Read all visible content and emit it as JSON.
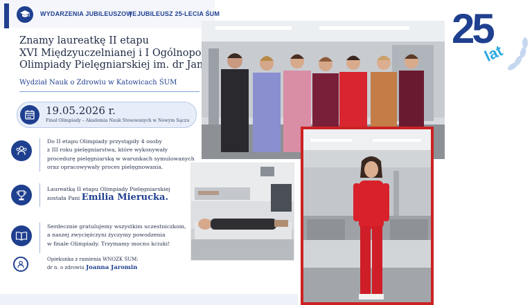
{
  "topbar": {
    "left_label": "WYDARZENIA JUBILEUSZOWE",
    "separator": "|",
    "right_label": "JUBILEUSZ 25-LECIA ŚUM"
  },
  "headline": {
    "lines": [
      "Znamy laureatkę II etapu",
      "XVI Międzyuczelnianej i I Ogólnopolskiej",
      "Olimpiady Pielęgniarskiej im. dr Janiny Fetlińskiej"
    ],
    "faculty": "Wydział Nauk o Zdrowiu w Katowicach ŚUM"
  },
  "event": {
    "date": "19.05.2026 r.",
    "subtitle": "Finał Olimpiady – Akademia Nauk Stosowanych w Nowym Sączu"
  },
  "info": {
    "participants_lines": [
      "Do II etapu Olimpiady przystąpiły 4 osoby",
      "z III roku pielęgniarstwa, które wykonywały",
      "procedurę pielęgniarską w warunkach symulowanych",
      "oraz opracowywały proces pielęgnowania."
    ],
    "winner_line1": "Laureatką II etapu Olimpiady Pielęgniarskiej",
    "winner_prefix": "została Pani",
    "winner_name": "Emilia Mierucka.",
    "congrats_lines": [
      "Serdecznie gratulujemy wszystkim uczestniczkom,",
      "a naszej zwyciężczyni życzymy powodzenia",
      "w finale Olimpiady. Trzymamy mocno kciuki!"
    ],
    "tutor_line1": "Opiekunka z ramienia WNOZK ŚUM:",
    "tutor_prefix": "dr n. o zdrowiu",
    "tutor_name": "Joanna Jaromin"
  },
  "logo": {
    "number": "25",
    "word": "lat"
  },
  "colors": {
    "navy": "#1f3f8f",
    "light_blue": "#2aa8e0",
    "red_frame": "#cc2222"
  },
  "icons": [
    "graduation-cap-icon",
    "calendar-icon",
    "people-icon",
    "trophy-icon",
    "book-icon",
    "person-icon"
  ]
}
